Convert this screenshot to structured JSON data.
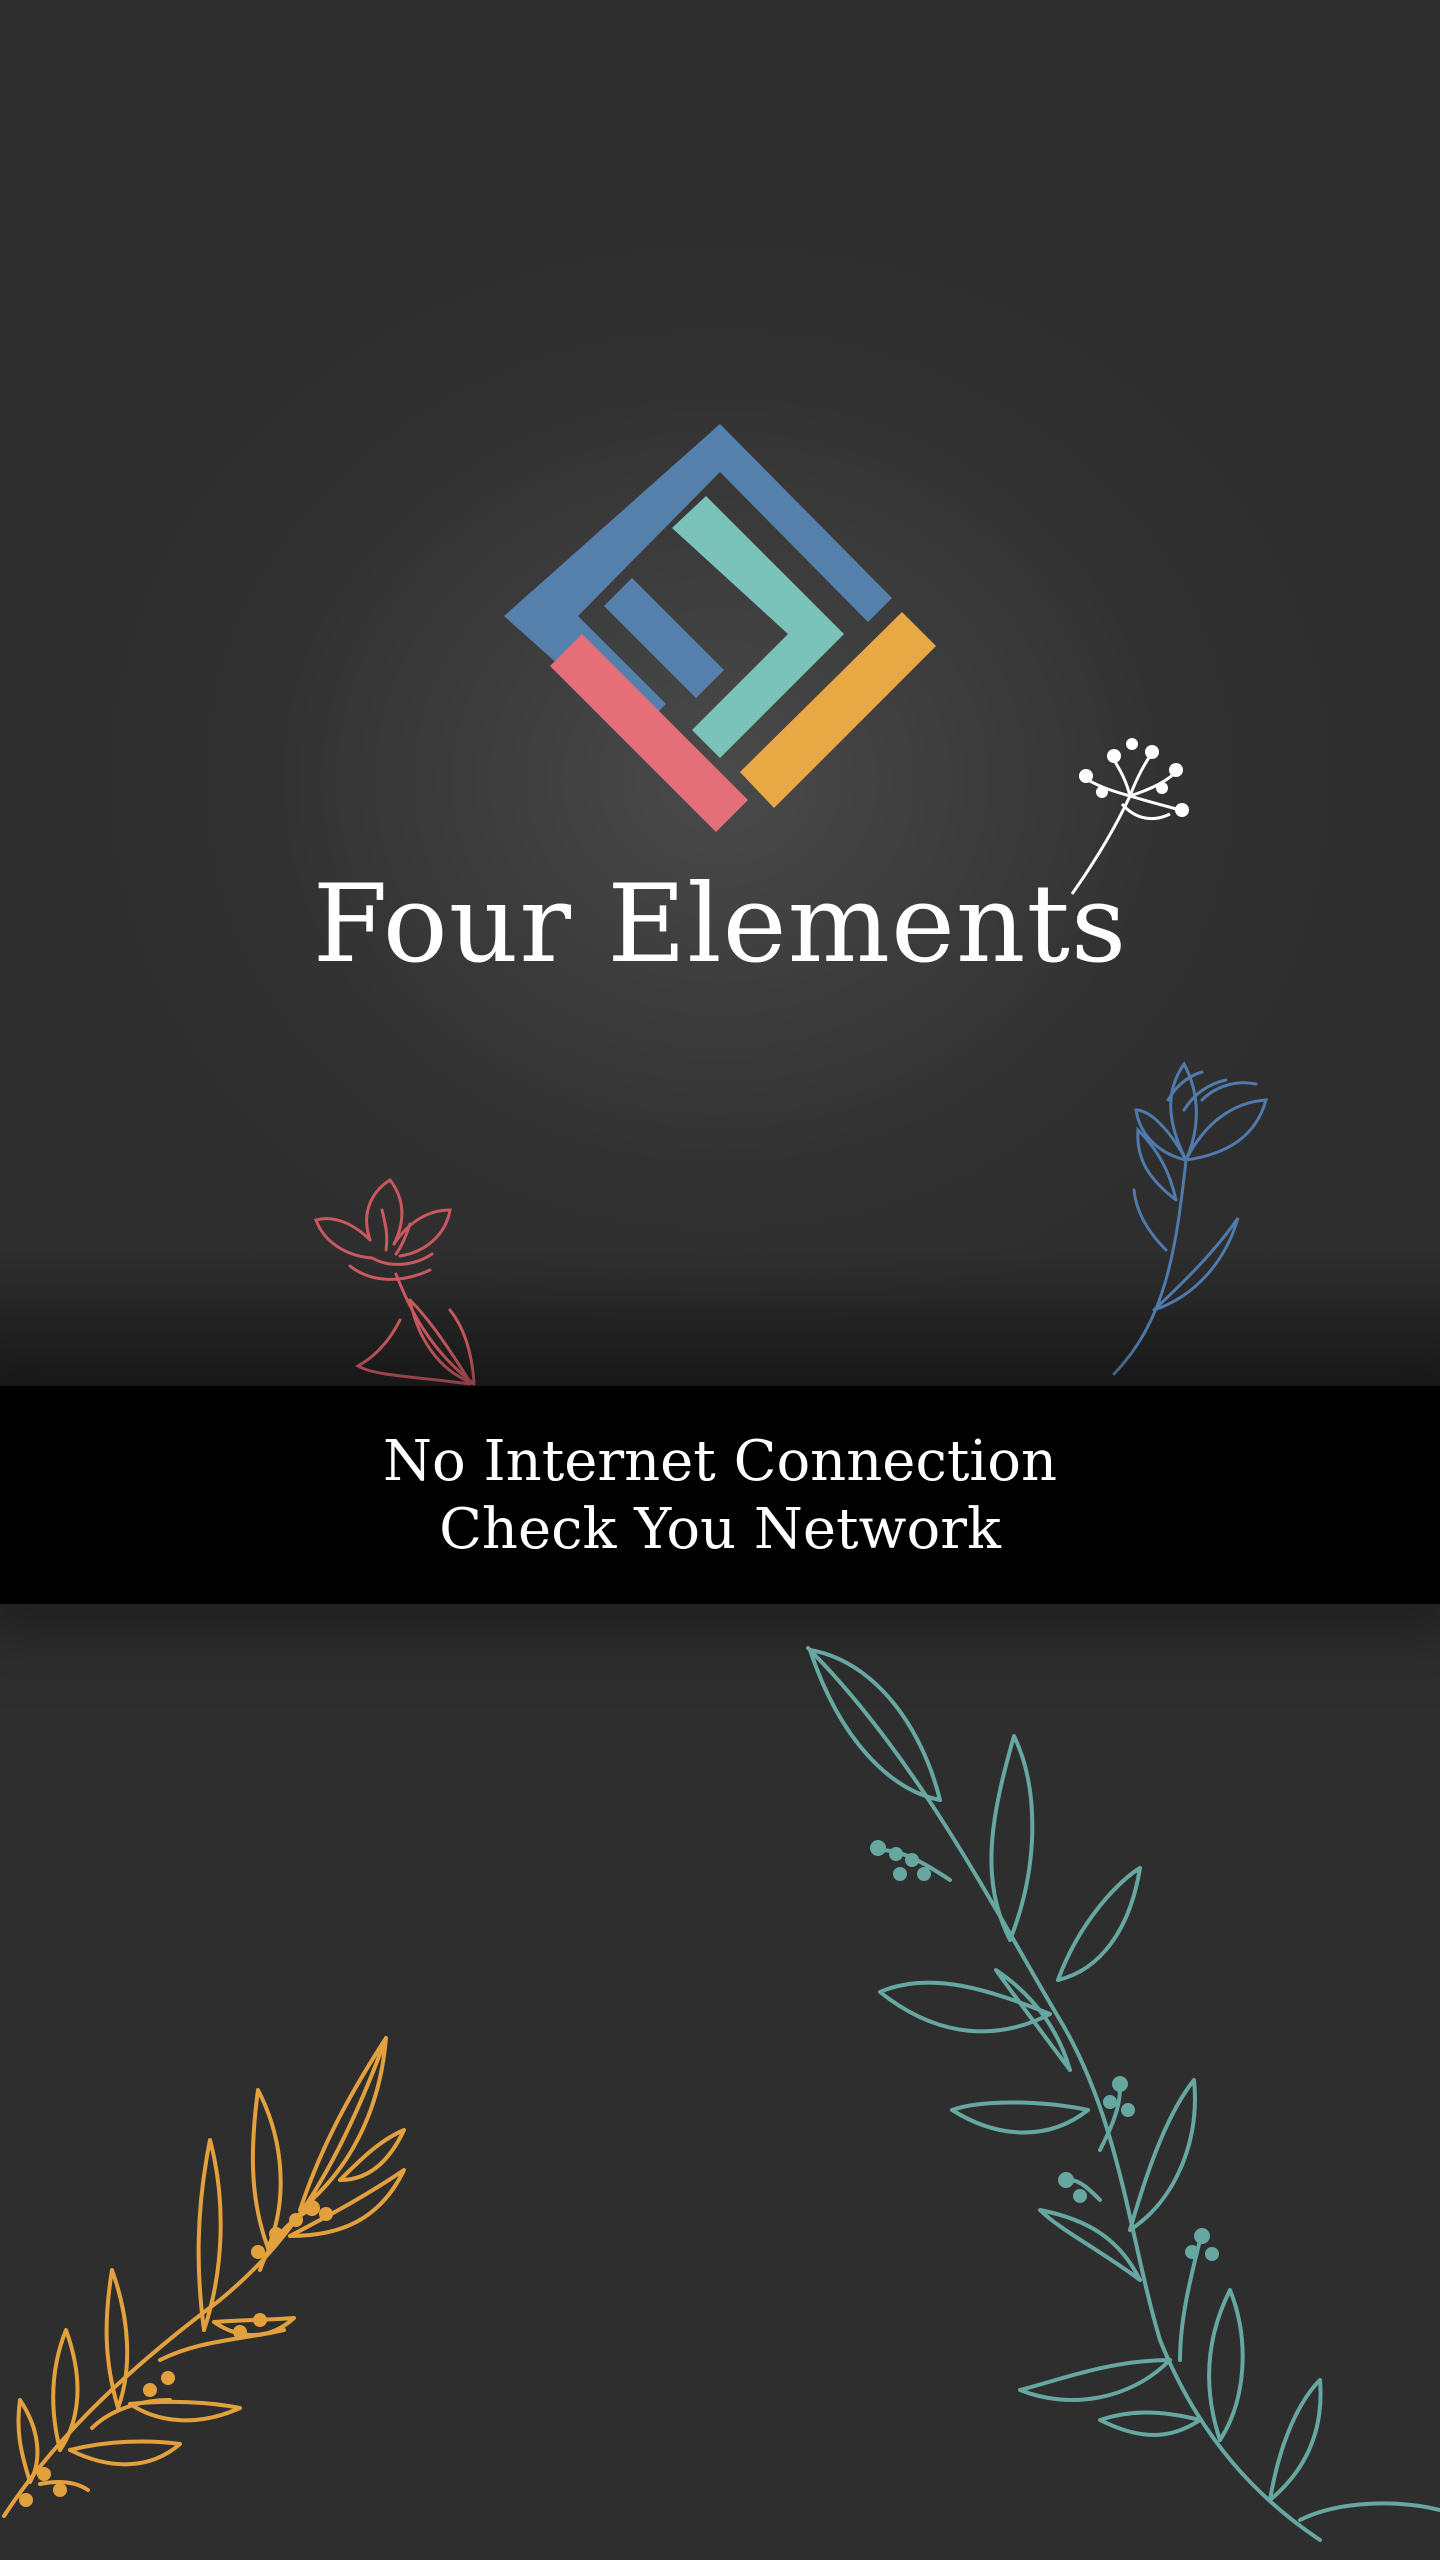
{
  "app": {
    "title": "Four Elements"
  },
  "logo": {
    "icon": "four-elements-logo",
    "colors": {
      "blue": "#5480ab",
      "teal": "#7ac2ba",
      "yellow": "#e8a945",
      "red": "#e46f78"
    }
  },
  "offline_banner": {
    "line1": "No Internet Connection",
    "line2": "Check You Network"
  },
  "decorations": [
    {
      "icon": "white-flower-sprig-icon",
      "color": "#ffffff"
    },
    {
      "icon": "blue-flower-icon",
      "color": "#4f7aab"
    },
    {
      "icon": "red-lotus-flower-icon",
      "color": "#c9585f"
    },
    {
      "icon": "teal-leafy-branch-icon",
      "color": "#66a8a1"
    },
    {
      "icon": "yellow-leafy-branch-icon",
      "color": "#e3a13d"
    }
  ],
  "theme": {
    "background": "#2e2e2e",
    "banner_background": "#000000",
    "text_color": "#ffffff"
  }
}
